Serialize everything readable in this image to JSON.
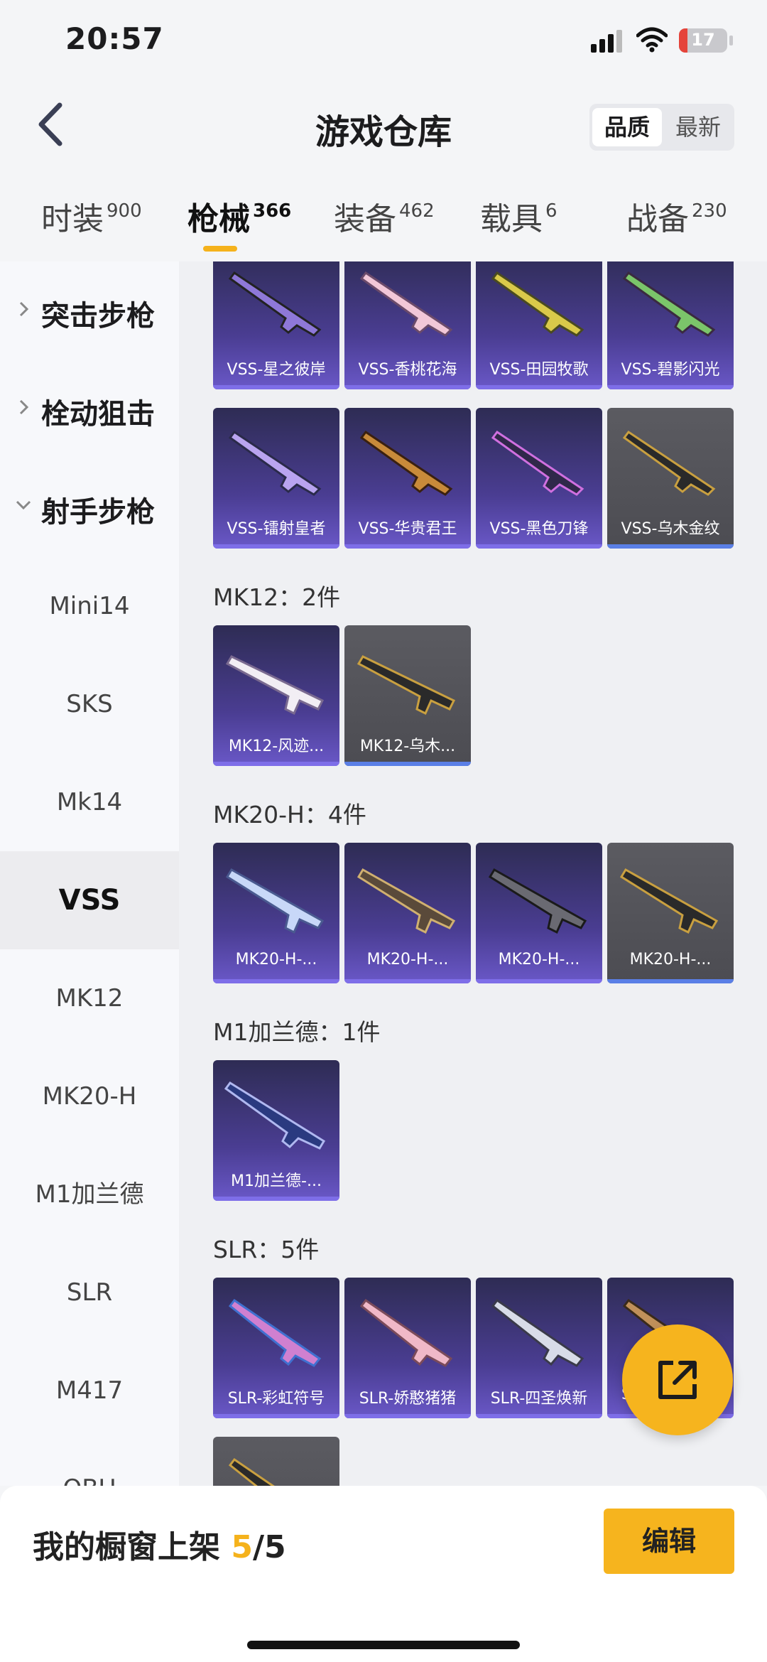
{
  "status": {
    "time": "20:57",
    "battery": "17",
    "battery_level": 0.17
  },
  "header": {
    "title": "游戏仓库",
    "sort": [
      "品质",
      "最新"
    ]
  },
  "tabs": [
    {
      "label": "时装",
      "count": "900"
    },
    {
      "label": "枪械",
      "count": "366"
    },
    {
      "label": "装备",
      "count": "462"
    },
    {
      "label": "载具",
      "count": "6"
    },
    {
      "label": "战备",
      "count": "230"
    }
  ],
  "sidebar": {
    "categories": [
      "突击步枪",
      "栓动狙击",
      "射手步枪"
    ],
    "items": [
      "Mini14",
      "SKS",
      "Mk14",
      "VSS",
      "MK12",
      "MK20-H",
      "M1加兰德",
      "SLR",
      "M417",
      "QBU"
    ]
  },
  "sections": [
    {
      "items": [
        "VSS-星之彼岸",
        "VSS-香桃花海",
        "VSS-田园牧歌",
        "VSS-碧影闪光"
      ]
    },
    {
      "items": [
        "VSS-镭射皇者",
        "VSS-华贵君王",
        "VSS-黑色刀锋",
        "VSS-乌木金纹"
      ]
    },
    {
      "header": "MK12：2件",
      "items": [
        "MK12-风迹...",
        "MK12-乌木..."
      ]
    },
    {
      "header": "MK20-H：4件",
      "items": [
        "MK20-H-...",
        "MK20-H-...",
        "MK20-H-...",
        "MK20-H-..."
      ]
    },
    {
      "header": "M1加兰德：1件",
      "items": [
        "M1加兰德-..."
      ]
    },
    {
      "header": "SLR：5件",
      "items": [
        "SLR-彩虹符号",
        "SLR-娇憨猪猪",
        "SLR-四圣焕新",
        "SL"
      ]
    }
  ],
  "footer": {
    "label": "我的橱窗上架 ",
    "count": "5",
    "total": "/5",
    "edit": "编辑"
  },
  "colors": {
    "accent": "#f6b41e",
    "card_purple": "#4a3d92",
    "card_gray": "#55555b"
  }
}
